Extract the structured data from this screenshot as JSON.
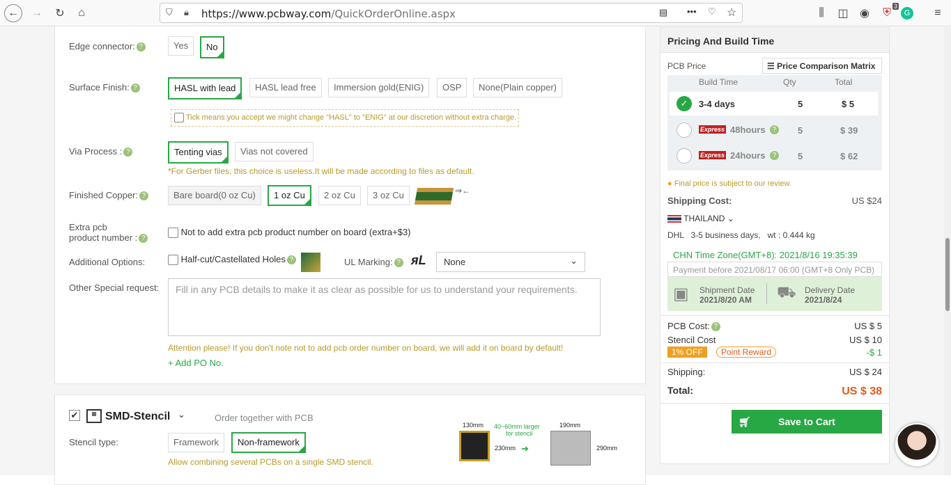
{
  "browser": {
    "url_host": "https://www.pcbway.com",
    "url_path": "/QuickOrderOnline.aspx",
    "badge_count": "3"
  },
  "form": {
    "edge_connector": {
      "label": "Edge connector:",
      "options": [
        "Yes",
        "No"
      ]
    },
    "surface_finish": {
      "label": "Surface Finish:",
      "options": [
        "HASL with lead",
        "HASL lead free",
        "Immersion gold(ENIG)",
        "OSP",
        "None(Plain copper)"
      ],
      "tick_note": "Tick means you accept we might change \"HASL\" to \"ENIG\" at our discretion without extra charge."
    },
    "via_process": {
      "label": "Via Process :",
      "options": [
        "Tenting vias",
        "Vias not covered"
      ],
      "note": "*For Gerber files, this choice is useless.It will be made according to files as default."
    },
    "finished_copper": {
      "label": "Finished Copper:",
      "options": [
        "Bare board(0 oz Cu)",
        "1 oz Cu",
        "2 oz Cu",
        "3 oz Cu"
      ]
    },
    "extra_pcb": {
      "label1": "Extra pcb",
      "label2": "product number :",
      "checkbox_label": "Not to add extra pcb product number on board (extra+$3)"
    },
    "additional": {
      "label": "Additional Options:",
      "half_cut": "Half-cut/Castellated Holes",
      "ul_label": "UL Marking:",
      "ul_value": "None"
    },
    "special": {
      "label": "Other Special request:",
      "placeholder": "Fill in any PCB details to make it as clear as possible for us to understand your requirements."
    },
    "attention": "Attention please! If you don't note not to add pcb order number on board, we will add it on board by default!",
    "add_po": "+ Add PO No."
  },
  "stencil": {
    "title": "SMD-Stencil",
    "order_together": "Order together with PCB",
    "type_label": "Stencil type:",
    "types": [
      "Framework",
      "Non-framework"
    ],
    "note": "Allow combining several PCBs on a single SMD stencil.",
    "dim1": "130mm",
    "dim2": "230mm",
    "dim3": "190mm",
    "dim4": "290mm",
    "larger1": "40~60mm larger",
    "larger2": "for stencil"
  },
  "pricing": {
    "title": "Pricing And Build Time",
    "pcb_price": "PCB Price",
    "matrix": "Price Comparison Matrix",
    "headers": [
      "Build Time",
      "Qty",
      "Total"
    ],
    "rows": [
      {
        "time": "3-4 days",
        "qty": "5",
        "total": "$ 5"
      },
      {
        "express": "Express",
        "time": "48hours",
        "qty": "5",
        "total": "$ 39"
      },
      {
        "express": "Express",
        "time": "24hours",
        "qty": "5",
        "total": "$ 62"
      }
    ],
    "final_note": "Final price is subject to our review.",
    "shipping_label": "Shipping Cost:",
    "shipping_value": "US $24",
    "country": "THAILAND",
    "dhl": "DHL   3-5 business days,   wt : 0.444 kg",
    "timezone": "CHN Time Zone(GMT+8): 2021/8/16 19:35:39",
    "payment": "Payment before 2021/08/17 06:00 (GMT+8 Only PCB)",
    "ship_date_label": "Shipment Date",
    "ship_date": "2021/8/20 AM",
    "delivery_label": "Delivery Date",
    "delivery_date": "2021/8/24",
    "pcb_cost_label": "PCB Cost:",
    "pcb_cost": "US $ 5",
    "stencil_cost_label": "Stencil Cost",
    "stencil_cost": "US $ 10",
    "off": "1% OFF",
    "reward": "Point Reward",
    "discount": "-$ 1",
    "shipping2_label": "Shipping:",
    "shipping2": "US $ 24",
    "total_label": "Total:",
    "total": "US $ 38",
    "cart": "Save to Cart"
  }
}
